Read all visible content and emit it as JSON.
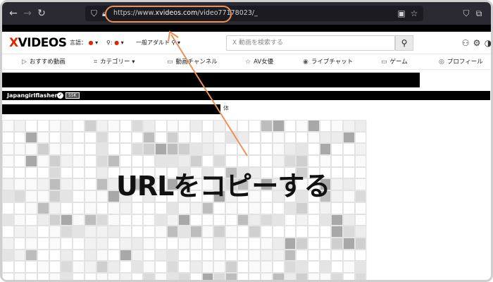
{
  "browser": {
    "url_prefix": "https://www.",
    "url_host": "xvideos.com",
    "url_path": "/video77178023/_"
  },
  "site": {
    "logo_x": "X",
    "logo_rest": "VIDEOS",
    "language_label": "言語：",
    "adult_filter_label": "一般アダルト",
    "search_placeholder": "X 動画を検索する"
  },
  "categories": [
    {
      "icon": "play-icon",
      "label": "おすすめ動画"
    },
    {
      "icon": "tag-icon",
      "label": "カテゴリー ▾"
    },
    {
      "icon": "tv-icon",
      "label": "動画チャンネル"
    },
    {
      "icon": "star-icon",
      "label": "AV女優"
    },
    {
      "icon": "live-icon",
      "label": "ライブチャット"
    },
    {
      "icon": "game-icon",
      "label": "ゲーム"
    },
    {
      "icon": "profile-icon",
      "label": "プロフィール"
    }
  ],
  "video": {
    "uploader": "Japangirlflasher",
    "count": "55K",
    "partial_text": "体"
  },
  "annotation": {
    "callout": "URLをコピーする",
    "color": "#e8925a"
  },
  "colors": {
    "browser_bg": "#2b2a33",
    "brand_red": "#de2600",
    "highlight": "#e8925a"
  }
}
